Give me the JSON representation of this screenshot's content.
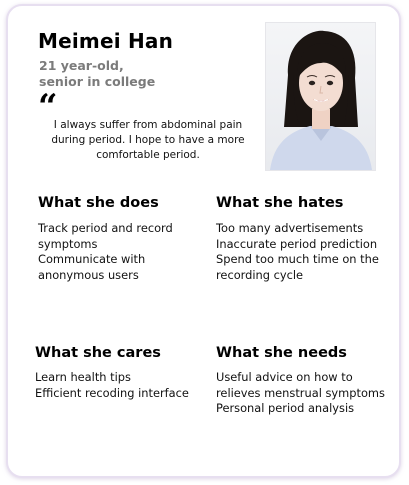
{
  "persona": {
    "name": "Meimei Han",
    "subtitle_line1": "21 year-old,",
    "subtitle_line2": "senior in college",
    "quote_mark": "“",
    "quote": "I always suffer from abdominal pain during period. I hope to have a more comfortable period.",
    "photo_icon": "portrait-photo"
  },
  "sections": {
    "does": {
      "title": "What she does",
      "items": [
        "Track period and record symptoms",
        "Communicate with anonymous users"
      ]
    },
    "hates": {
      "title": "What she hates",
      "items": [
        "Too many advertisements",
        "Inaccurate period prediction",
        "Spend too much time on the recording cycle"
      ]
    },
    "cares": {
      "title": "What she cares",
      "items": [
        "Learn health tips",
        "Efficient recoding interface"
      ]
    },
    "needs": {
      "title": "What she needs",
      "items": [
        "Useful advice on how to relieves menstrual symptoms",
        "Personal period analysis"
      ]
    }
  },
  "colors": {
    "card_border": "#e7dff0",
    "subtitle": "#7b7b7b",
    "shirt": "#cfd8ec",
    "hair": "#1b1512",
    "skin": "#f3ddd2"
  }
}
